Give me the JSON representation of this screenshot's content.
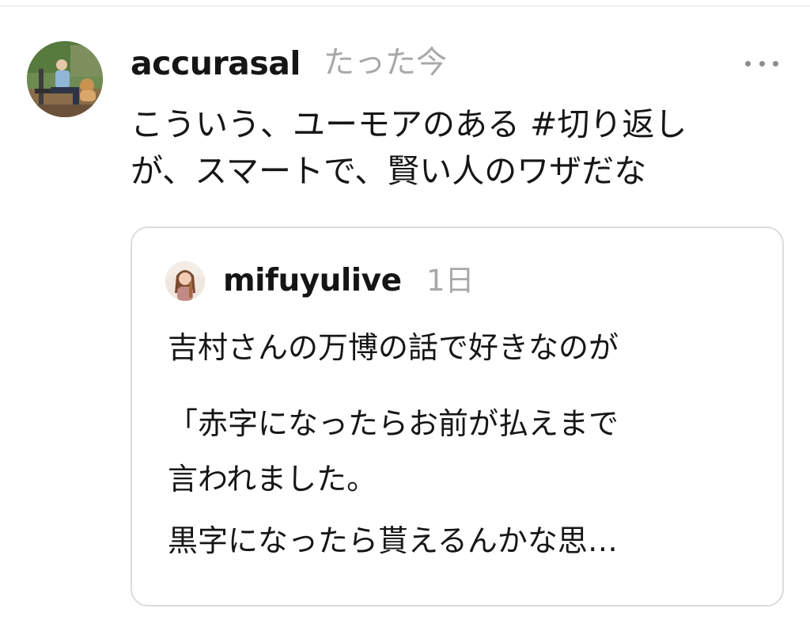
{
  "post": {
    "username": "accurasal",
    "timestamp": "たった今",
    "text_lines": [
      "こういう、ユーモアのある #切り返し",
      "が、スマートで、賢い人のワザだな"
    ]
  },
  "quoted_post": {
    "username": "mifuyulive",
    "timestamp": "1日",
    "text_lines": [
      "吉村さんの万博の話で好きなのが",
      "「赤字になったらお前が払えまで",
      "言われました。",
      "黒字になったら貰えるんかな思…"
    ]
  },
  "icons": {
    "more": "more-horizontal-icon",
    "avatar": "user-avatar-photo",
    "quote_avatar": "quoted-user-avatar-photo"
  },
  "colors": {
    "text": "#161616",
    "muted": "#a8a8a8",
    "border": "#dcdcdc",
    "background": "#ffffff"
  }
}
